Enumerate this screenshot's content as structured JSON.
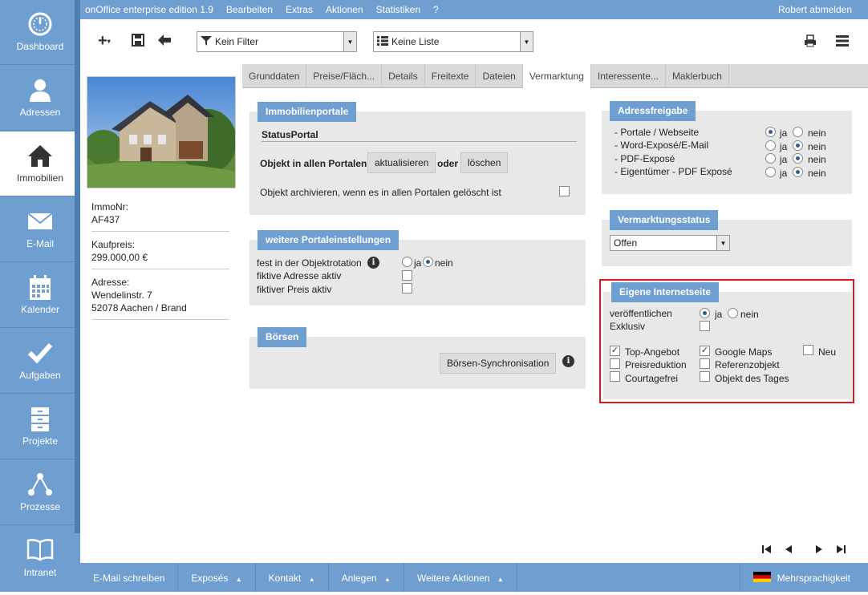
{
  "sidebar": {
    "items": [
      {
        "label": "Dashboard",
        "icon": "gauge-icon"
      },
      {
        "label": "Adressen",
        "icon": "person-icon"
      },
      {
        "label": "Immobilien",
        "icon": "house-icon"
      },
      {
        "label": "E-Mail",
        "icon": "envelope-icon"
      },
      {
        "label": "Kalender",
        "icon": "calendar-icon"
      },
      {
        "label": "Aufgaben",
        "icon": "checkmark-icon"
      },
      {
        "label": "Projekte",
        "icon": "cabinet-icon"
      },
      {
        "label": "Prozesse",
        "icon": "process-icon"
      },
      {
        "label": "Intranet",
        "icon": "book-icon"
      }
    ],
    "active": "Immobilien"
  },
  "topbar": {
    "menu": [
      "onOffice enterprise edition 1.9",
      "Bearbeiten",
      "Extras",
      "Aktionen",
      "Statistiken",
      "?"
    ],
    "logout": "Robert abmelden"
  },
  "toolbar": {
    "filter_value": "Kein Filter",
    "list_value": "Keine Liste"
  },
  "object": {
    "immonr_label": "ImmoNr:",
    "immonr_value": "AF437",
    "price_label": "Kaufpreis:",
    "price_value": "299.000,00 €",
    "address_label": "Adresse:",
    "address_line1": "Wendelinstr. 7",
    "address_line2": "52078 Aachen / Brand"
  },
  "tabs": [
    "Grunddaten",
    "Preise/Fläch...",
    "Details",
    "Freitexte",
    "Dateien",
    "Vermarktung",
    "Interessente...",
    "Maklerbuch"
  ],
  "active_tab": "Vermarktung",
  "immobilienportale": {
    "title": "Immobilienportale",
    "status_label": "StatusPortal",
    "all_portals_label": "Objekt in allen Portalen",
    "update_button": "aktualisieren",
    "or_label": "oder",
    "delete_button": "löschen",
    "archive_label": "Objekt archivieren, wenn es in allen Portalen gelöscht ist"
  },
  "weitere": {
    "title": "weitere Portaleinstellungen",
    "rotation_label": "fest in der Objektrotation",
    "fictive_address_label": "fiktive Adresse aktiv",
    "fictive_price_label": "fiktiver Preis aktiv",
    "yes": "ja",
    "no": "nein",
    "rotation_value": "nein"
  },
  "boersen": {
    "title": "Börsen",
    "sync_button": "Börsen-Synchronisation"
  },
  "adressfreigabe": {
    "title": "Adressfreigabe",
    "yes": "ja",
    "no": "nein",
    "rows": [
      {
        "label": "- Portale / Webseite",
        "value": "ja"
      },
      {
        "label": "- Word-Exposé/E-Mail",
        "value": "nein"
      },
      {
        "label": "- PDF-Exposé",
        "value": "nein"
      },
      {
        "label": "- Eigentümer - PDF Exposé",
        "value": "nein"
      }
    ]
  },
  "vermarktungsstatus": {
    "title": "Vermarktungsstatus",
    "value": "Offen"
  },
  "internetseite": {
    "title": "Eigene Internetseite",
    "publish_label": "veröffentlichen",
    "publish_value": "ja",
    "yes": "ja",
    "no": "nein",
    "exclusive_label": "Exklusiv",
    "options": {
      "top_angebot": "Top-Angebot",
      "preisreduktion": "Preisreduktion",
      "courtagefrei": "Courtagefrei",
      "google_maps": "Google Maps",
      "referenzobjekt": "Referenzobjekt",
      "objekt_des_tages": "Objekt des Tages",
      "neu": "Neu"
    },
    "checked": [
      "Top-Angebot",
      "Google Maps"
    ]
  },
  "bottombar": {
    "items": [
      "E-Mail schreiben",
      "Exposés",
      "Kontakt",
      "Anlegen",
      "Weitere Aktionen"
    ],
    "language": "Mehrsprachigkeit"
  },
  "colors": {
    "accent": "#6f9fd0",
    "highlight_border": "#e0161e"
  }
}
